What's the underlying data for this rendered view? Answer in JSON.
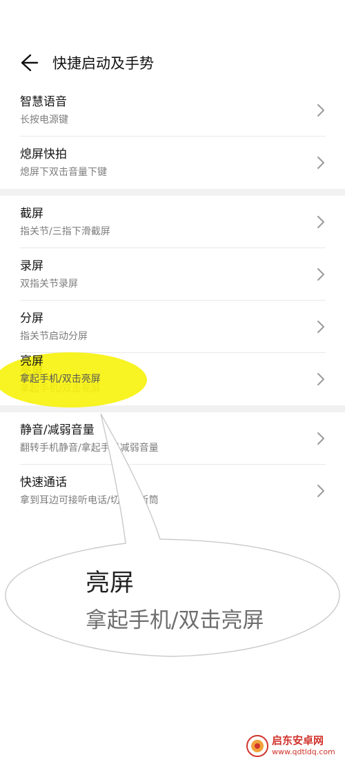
{
  "header": {
    "title": "快捷启动及手势",
    "back_icon": "back-arrow-icon"
  },
  "groups": [
    {
      "items": [
        {
          "title": "智慧语音",
          "subtitle": "长按电源键"
        },
        {
          "title": "熄屏快拍",
          "subtitle": "熄屏下双击音量下键"
        }
      ]
    },
    {
      "items": [
        {
          "title": "截屏",
          "subtitle": "指关节/三指下滑截屏"
        },
        {
          "title": "录屏",
          "subtitle": "双指关节录屏"
        },
        {
          "title": "分屏",
          "subtitle": "指关节启动分屏"
        },
        {
          "title": "亮屏",
          "subtitle": "拿起手机/双击亮屏"
        }
      ]
    },
    {
      "items": [
        {
          "title": "静音/减弱音量",
          "subtitle": "翻转手机静音/拿起手机减弱音量"
        },
        {
          "title": "快速通话",
          "subtitle": "拿到耳边可接听电话/切换为听筒"
        }
      ]
    }
  ],
  "callout": {
    "title": "亮屏",
    "subtitle": "拿起手机/双击亮屏"
  },
  "watermark": {
    "name": "启东安卓网",
    "url": "www.qdtldq.com"
  },
  "colors": {
    "highlight": "#f7f20a",
    "watermark": "#d0342c",
    "gap": "#f1f1f1"
  }
}
